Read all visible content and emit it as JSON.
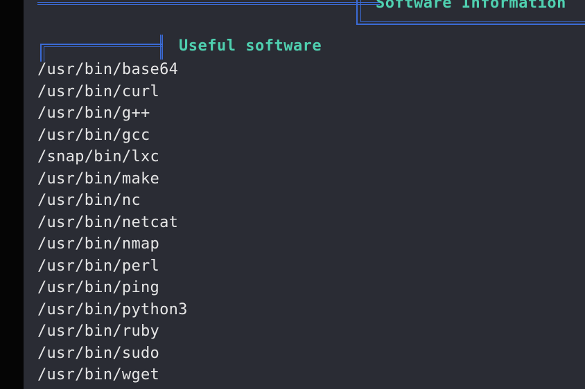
{
  "sections": {
    "top_title": "Software Information",
    "subsection_title": "Useful software"
  },
  "software": [
    "/usr/bin/base64",
    "/usr/bin/curl",
    "/usr/bin/g++",
    "/usr/bin/gcc",
    "/snap/bin/lxc",
    "/usr/bin/make",
    "/usr/bin/nc",
    "/usr/bin/netcat",
    "/usr/bin/nmap",
    "/usr/bin/perl",
    "/usr/bin/ping",
    "/usr/bin/python3",
    "/usr/bin/ruby",
    "/usr/bin/sudo",
    "/usr/bin/wget"
  ],
  "colors": {
    "background": "#2a2c34",
    "heading": "#4fd0b0",
    "border": "#3b6bd6",
    "text": "#e6e6e6"
  }
}
